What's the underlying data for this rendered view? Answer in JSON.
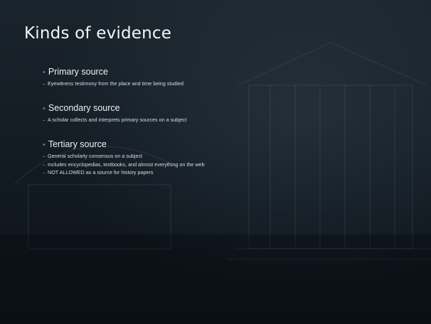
{
  "slide": {
    "title": "Kinds of evidence",
    "items": [
      {
        "label": "Primary source",
        "subitems": [
          "Eyewitness testimony from the place and time being studied"
        ]
      },
      {
        "label": "Secondary source",
        "subitems": [
          "A scholar collects and interprets primary sources on a subject"
        ]
      },
      {
        "label": "Tertiary source",
        "subitems": [
          "General scholarly consensus on a subject",
          "Includes encyclopedias, textbooks, and almost everything on the web",
          "NOT ALLOWED as a source for history papers"
        ]
      }
    ],
    "bullet_glyph": "•",
    "dash_glyph": "–"
  },
  "colors": {
    "background": "#121a21",
    "text": "#e8ecef",
    "bullet": "#5f7a8c"
  }
}
